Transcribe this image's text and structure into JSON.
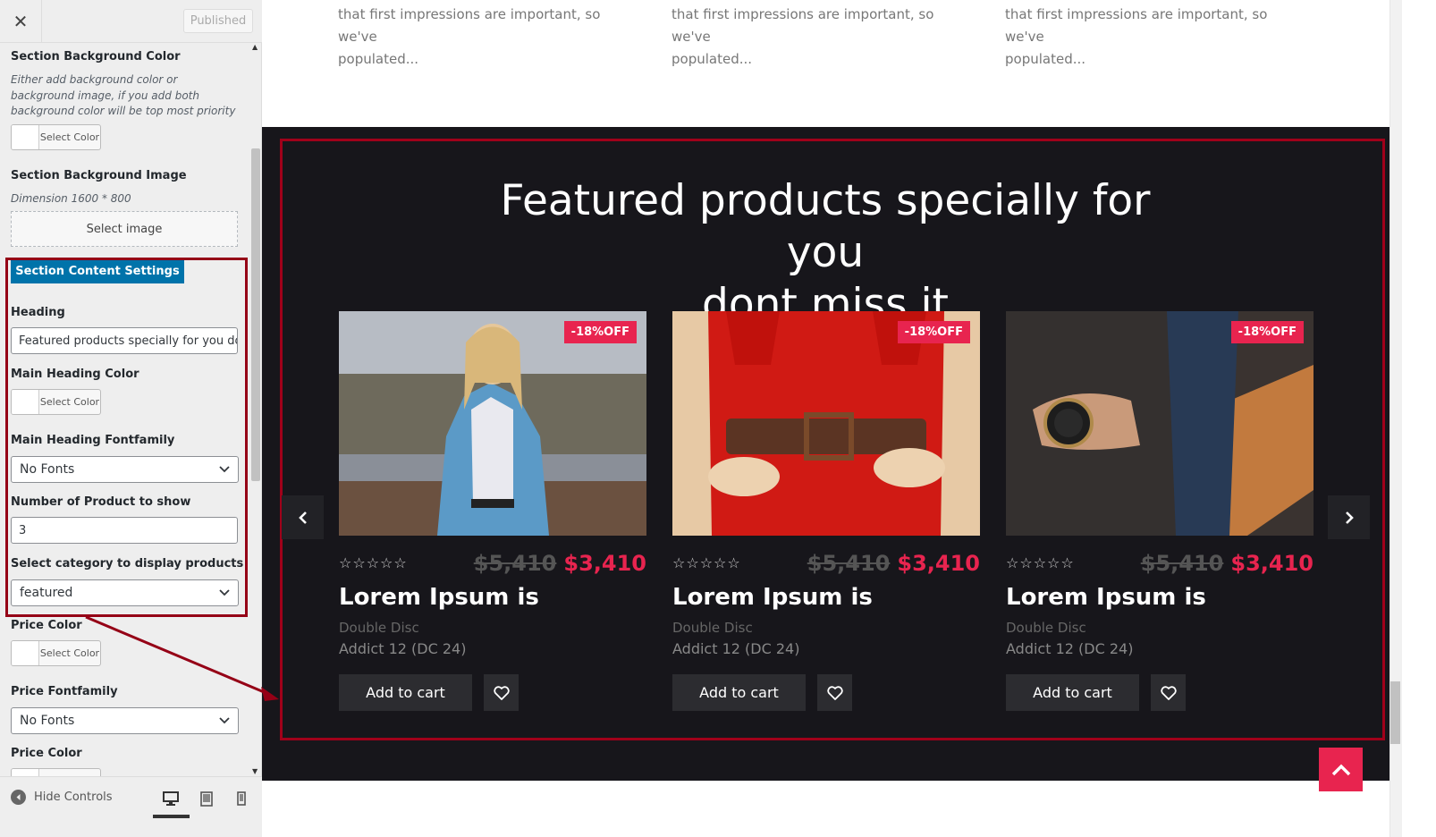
{
  "sidebar": {
    "close_icon": "close-icon",
    "published_label": "Published",
    "controls": {
      "bg_color_title": "Section Background Color",
      "bg_color_desc": "Either add background color or background image, if you add both background color will be top most priority",
      "select_color_label": "Select Color",
      "bg_image_title": "Section Background Image",
      "bg_image_desc": "Dimension 1600 * 800",
      "select_image_label": "Select image",
      "content_settings_tab": "Section Content Settings",
      "heading_title": "Heading",
      "heading_value": "Featured products specially for you dont miss it",
      "main_heading_color_title": "Main Heading Color",
      "main_heading_font_title": "Main Heading Fontfamily",
      "main_heading_font_value": "No Fonts",
      "num_products_title": "Number of Product to show",
      "num_products_value": "3",
      "category_title": "Select category to display products",
      "category_value": "featured",
      "price_color_title": "Price Color",
      "price_font_title": "Price Fontfamily",
      "price_font_value": "No Fonts",
      "price_color_title_2": "Price Color"
    },
    "footer": {
      "hide_controls_label": "Hide Controls",
      "devices": [
        "desktop-icon",
        "tablet-icon",
        "mobile-icon"
      ],
      "active_device": "desktop"
    }
  },
  "preview": {
    "teasers": [
      {
        "line1": "that first impressions are important, so we've",
        "line2": "populated..."
      },
      {
        "line1": "that first impressions are important, so we've",
        "line2": "populated..."
      },
      {
        "line1": "that first impressions are important, so we've",
        "line2": "populated..."
      }
    ],
    "featured": {
      "heading_line1": "Featured products specially for you",
      "heading_line2": "dont miss it",
      "products": [
        {
          "badge": "-18%OFF",
          "rating": "☆☆☆☆☆",
          "old_price": "$5,410",
          "price": "$3,410",
          "title": "Lorem Ipsum is",
          "category": "Double Disc",
          "model": "Addict 12 (DC 24)",
          "cart_label": "Add to cart",
          "image": "woman-denim-jacket-photo"
        },
        {
          "badge": "-18%OFF",
          "rating": "☆☆☆☆☆",
          "old_price": "$5,410",
          "price": "$3,410",
          "title": "Lorem Ipsum is",
          "category": "Double Disc",
          "model": "Addict 12 (DC 24)",
          "cart_label": "Add to cart",
          "image": "red-dress-belt-photo"
        },
        {
          "badge": "-18%OFF",
          "rating": "☆☆☆☆☆",
          "old_price": "$5,410",
          "price": "$3,410",
          "title": "Lorem Ipsum is",
          "category": "Double Disc",
          "model": "Addict 12 (DC 24)",
          "cart_label": "Add to cart",
          "image": "man-suit-watch-photo"
        }
      ]
    },
    "icons": {
      "prev": "chevron-left-icon",
      "next": "chevron-right-icon",
      "wishlist": "heart-icon",
      "back_to_top": "chevron-up-icon"
    }
  },
  "colors": {
    "accent": "#e8244f",
    "annotation": "#a0001a",
    "wp_blue": "#0073aa",
    "dark_bg": "#17161b"
  }
}
